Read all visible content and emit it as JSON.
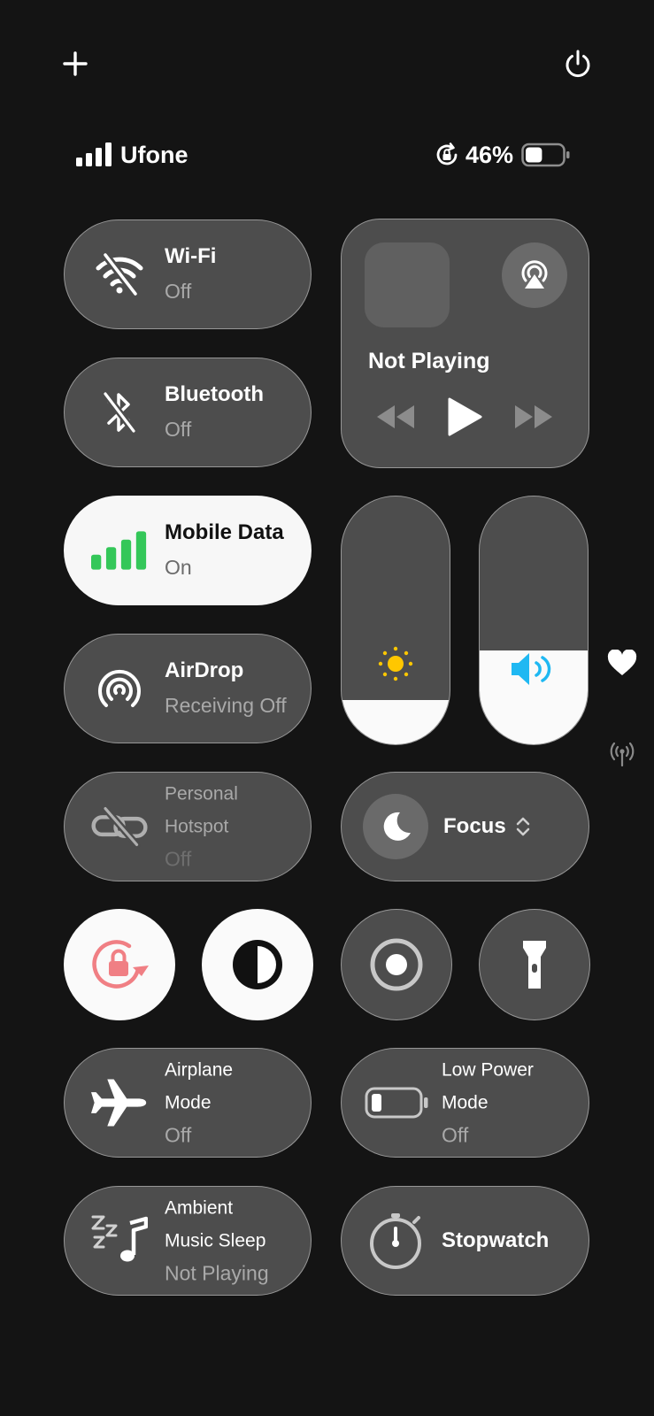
{
  "top": {
    "add_icon": "plus-icon",
    "power_icon": "power-icon"
  },
  "status_bar": {
    "carrier": "Ufone",
    "battery_percent": "46%",
    "battery_level": 0.46
  },
  "connectivity": {
    "wifi": {
      "title": "Wi-Fi",
      "status": "Off"
    },
    "bluetooth": {
      "title": "Bluetooth",
      "status": "Off"
    },
    "mobile_data": {
      "title": "Mobile Data",
      "status": "On"
    },
    "airdrop": {
      "title": "AirDrop",
      "status": "Receiving Off"
    },
    "hotspot": {
      "title_line1": "Personal",
      "title_line2": "Hotspot",
      "status": "Off"
    }
  },
  "media": {
    "title": "Not Playing"
  },
  "sliders": {
    "brightness_level": 0.18,
    "volume_level": 0.38
  },
  "focus": {
    "label": "Focus"
  },
  "toggles": {
    "airplane": {
      "title_line1": "Airplane",
      "title_line2": "Mode",
      "status": "Off"
    },
    "low_power": {
      "title_line1": "Low Power",
      "title_line2": "Mode",
      "status": "Off"
    },
    "ambient": {
      "title_line1": "Ambient",
      "title_line2": "Music Sleep",
      "status": "Not Playing"
    },
    "stopwatch": {
      "title": "Stopwatch"
    }
  },
  "colors": {
    "accent_green": "#34c759",
    "accent_blue": "#1fb8f2",
    "rotation_lock_red": "#f07f84",
    "brightness_yellow": "#ffc700"
  }
}
